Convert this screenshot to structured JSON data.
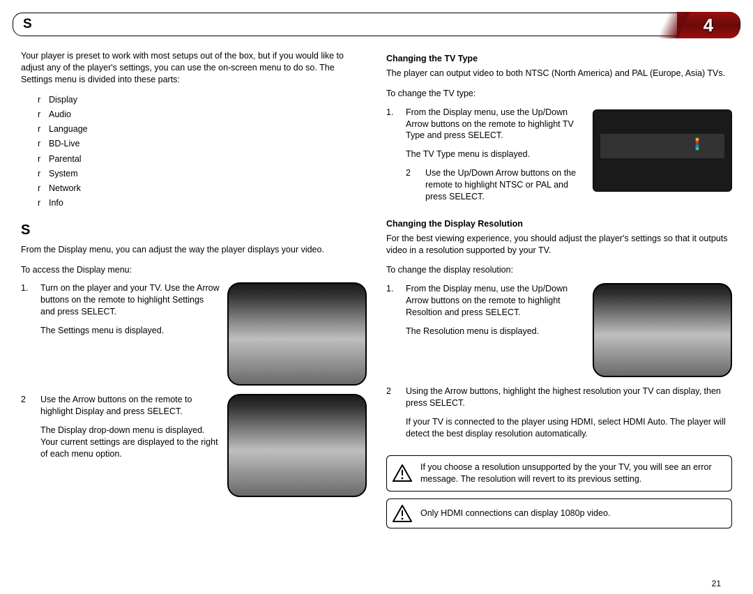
{
  "header": {
    "title": "S",
    "chapter": "4"
  },
  "left": {
    "intro": "Your player is preset to work with most setups out of the box, but if you would like to adjust any of the player's settings, you can use the on-screen menu to do so. The Settings menu is divided into these parts:",
    "bullets": [
      "Display",
      "Audio",
      "Language",
      "BD-Live",
      "Parental",
      "System",
      "Network",
      "Info"
    ],
    "section_head": "S",
    "section_intro": "From the Display menu, you can adjust the way the player displays your video.",
    "access_lead": "To access the Display menu:",
    "step1_n": "1.",
    "step1_a": "Turn on the player and your TV. Use the Arrow buttons on the remote to highlight Settings and press SELECT.",
    "step1_b": "The Settings menu is displayed.",
    "step2_n": "2",
    "step2_a": "Use the Arrow buttons on the remote to highlight Display and press SELECT.",
    "step2_b": "The Display drop-down menu is displayed. Your current settings are displayed to the right of each menu option."
  },
  "right": {
    "tv_head": "Changing the TV Type",
    "tv_intro": "The player can output video to both NTSC (North America) and PAL (Europe, Asia) TVs.",
    "tv_lead": "To change the TV type:",
    "tv_s1_n": "1.",
    "tv_s1_a": "From the Display menu, use the Up/Down Arrow buttons on the remote to highlight TV Type and press SELECT.",
    "tv_s1_b": "The TV Type menu is displayed.",
    "tv_s2_n": "2",
    "tv_s2_a": "Use the Up/Down Arrow buttons on the remote to highlight NTSC or PAL and press SELECT.",
    "res_head": "Changing the Display Resolution",
    "res_intro": "For the best viewing experience, you should adjust the player's settings so that it outputs video in a resolution supported by your TV.",
    "res_lead": "To change the display resolution:",
    "res_s1_n": "1.",
    "res_s1_a": "From the Display menu, use the Up/Down Arrow buttons on the remote to highlight Resoltion and press SELECT.",
    "res_s1_b": "The Resolution menu is displayed.",
    "res_s2_n": "2",
    "res_s2_a": "Using the Arrow buttons, highlight the highest resolution your TV can display, then press SELECT.",
    "res_s2_b": "If your TV is connected to the player using HDMI, select HDMI Auto. The player will detect the best display resolution automatically.",
    "warn1": "If you choose a resolution unsupported by the your TV, you will see an error message. The resolution will revert to its previous setting.",
    "warn2": "Only HDMI connections can display 1080p video."
  },
  "page_number": "21"
}
